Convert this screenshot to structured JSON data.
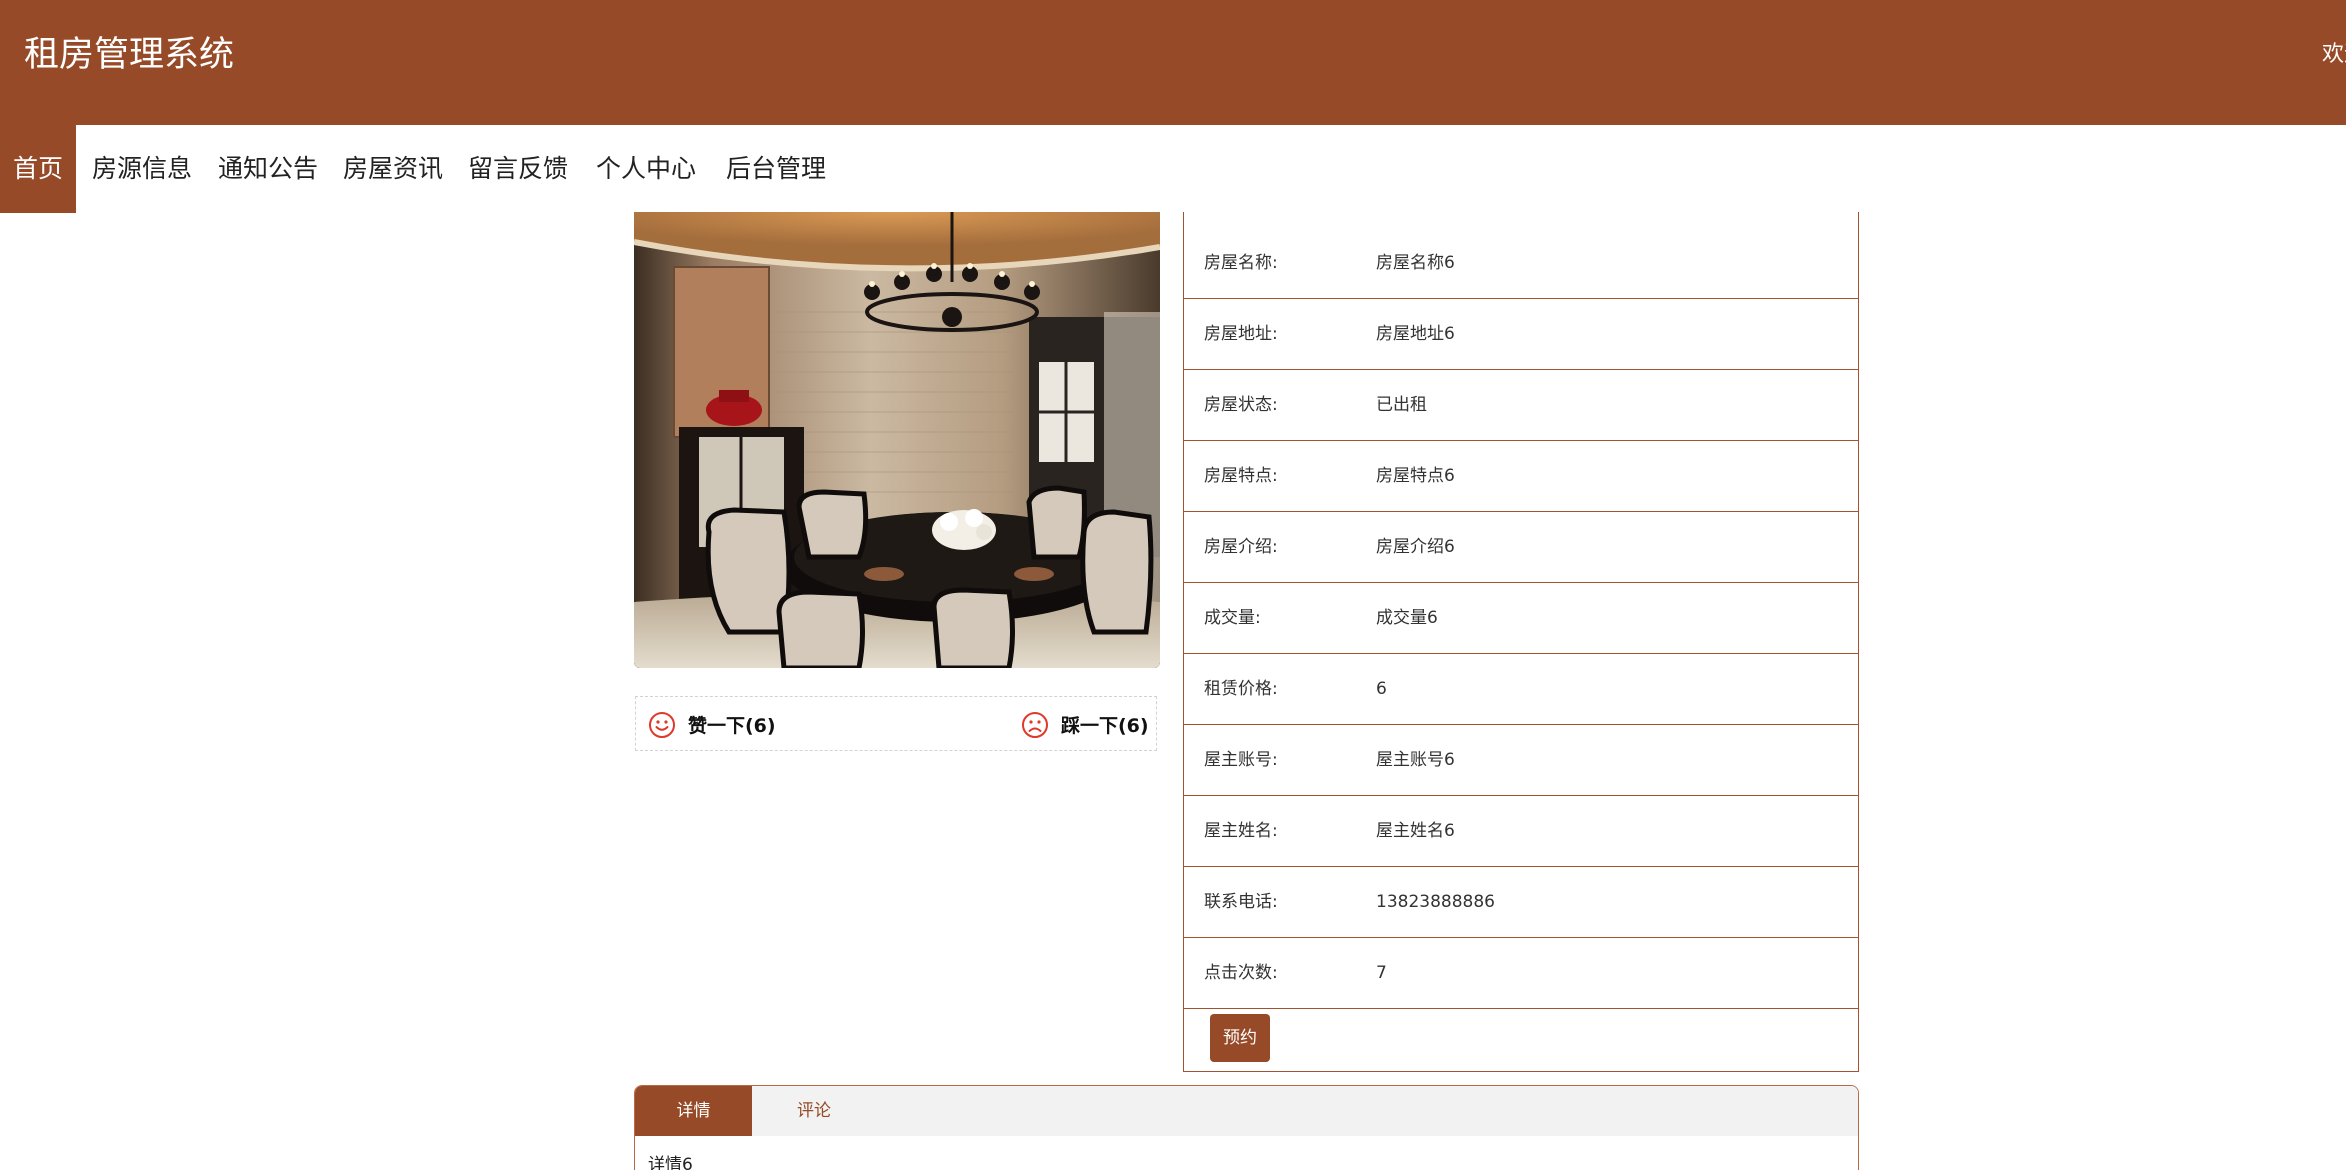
{
  "header": {
    "app_title": "租房管理系统",
    "welcome_text": "欢迎"
  },
  "nav": {
    "items": [
      {
        "label": "首页",
        "active": true
      },
      {
        "label": "房源信息",
        "active": false
      },
      {
        "label": "通知公告",
        "active": false
      },
      {
        "label": "房屋资讯",
        "active": false
      },
      {
        "label": "留言反馈",
        "active": false
      },
      {
        "label": "个人中心",
        "active": false
      },
      {
        "label": "后台管理",
        "active": false
      }
    ]
  },
  "house": {
    "photo": {
      "subject": "dining room interior with chandelier"
    },
    "votes": {
      "like_label": "赞一下(6)",
      "dislike_label": "踩一下(6)"
    },
    "details": [
      {
        "label": "房屋名称:",
        "value": "房屋名称6"
      },
      {
        "label": "房屋地址:",
        "value": "房屋地址6"
      },
      {
        "label": "房屋状态:",
        "value": "已出租"
      },
      {
        "label": "房屋特点:",
        "value": "房屋特点6"
      },
      {
        "label": "房屋介绍:",
        "value": "房屋介绍6"
      },
      {
        "label": "成交量:",
        "value": "成交量6"
      },
      {
        "label": "租赁价格:",
        "value": "6"
      },
      {
        "label": "屋主账号:",
        "value": "屋主账号6"
      },
      {
        "label": "屋主姓名:",
        "value": "屋主姓名6"
      },
      {
        "label": "联系电话:",
        "value": "13823888886"
      },
      {
        "label": "点击次数:",
        "value": "7"
      }
    ],
    "book_button_label": "预约"
  },
  "tabs": {
    "items": [
      {
        "label": "详情",
        "active": true
      },
      {
        "label": "评论",
        "active": false
      }
    ],
    "content": "详情6"
  },
  "colors": {
    "brand": "#964a27",
    "border": "#a0532f",
    "tab_bg": "#f2f2f2"
  }
}
